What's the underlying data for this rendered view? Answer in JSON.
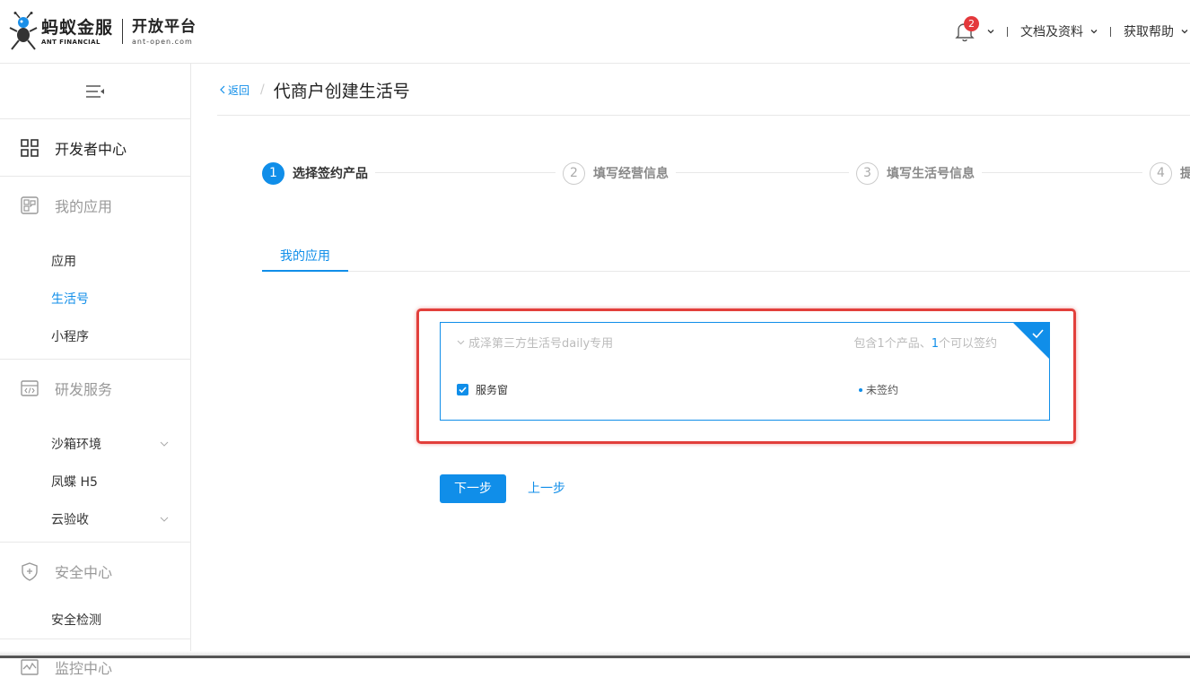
{
  "header": {
    "logo_cn": "蚂蚁金服",
    "logo_en": "ANT FINANCIAL",
    "platform": "开放平台",
    "domain": "ant-open.com",
    "notification_count": "2",
    "docs_label": "文档及资料",
    "help_label": "获取帮助"
  },
  "sidebar": {
    "developer_center": "开发者中心",
    "my_apps": {
      "label": "我的应用",
      "items": [
        "应用",
        "生活号",
        "小程序"
      ],
      "active": "生活号"
    },
    "dev_services": {
      "label": "研发服务",
      "items": [
        "沙箱环境",
        "凤蝶 H5",
        "云验收"
      ]
    },
    "security": {
      "label": "安全中心",
      "items": [
        "安全检测"
      ]
    },
    "monitor": {
      "label": "监控中心"
    }
  },
  "main": {
    "back_label": "返回",
    "breadcrumb_sep": "/",
    "title": "代商户创建生活号",
    "steps": [
      {
        "num": "1",
        "label": "选择签约产品"
      },
      {
        "num": "2",
        "label": "填写经营信息"
      },
      {
        "num": "3",
        "label": "填写生活号信息"
      },
      {
        "num": "4",
        "label": "提交"
      }
    ],
    "current_step": 1,
    "tab_label": "我的应用",
    "card": {
      "app_name": "成泽第三方生活号daily专用",
      "count_prefix": "包含1个产品、",
      "count_num": "1",
      "count_suffix": "个可以签约",
      "product_name": "服务窗",
      "product_status": "未签约",
      "checked": true
    },
    "next_label": "下一步",
    "prev_label": "上一步"
  },
  "colors": {
    "primary": "#108ee9",
    "badge": "#e4393c",
    "highlight": "#e23f3b"
  }
}
